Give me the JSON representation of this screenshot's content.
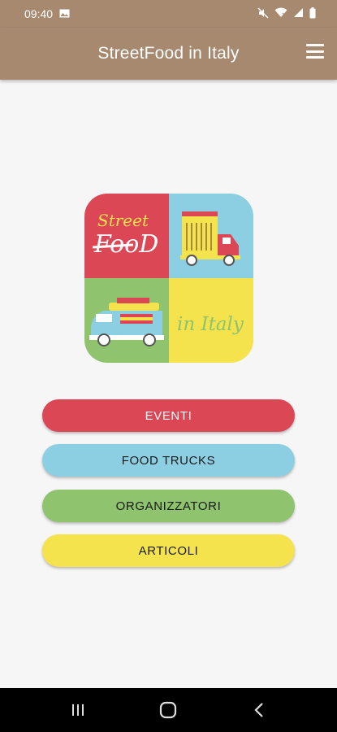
{
  "status_bar": {
    "time": "09:40",
    "icons": [
      "image-icon",
      "mute-icon",
      "wifi-icon",
      "signal-icon",
      "battery-icon"
    ]
  },
  "app_bar": {
    "title": "StreetFood in Italy",
    "menu_icon": "hamburger-menu-icon",
    "background_color": "#a6896f"
  },
  "logo": {
    "top_left_text_1": "Street",
    "top_left_text_2": "FooD",
    "bottom_right_text": "in Italy",
    "colors": {
      "red": "#dc4756",
      "blue": "#8dcfe2",
      "green": "#8fc36e",
      "yellow": "#f4e34d"
    }
  },
  "menu_buttons": [
    {
      "label": "EVENTI",
      "color": "#dc4756",
      "text_color": "#ffffff"
    },
    {
      "label": "FOOD TRUCKS",
      "color": "#8dcfe2",
      "text_color": "#1a1a1a"
    },
    {
      "label": "ORGANIZZATORI",
      "color": "#8fc36e",
      "text_color": "#1a1a1a"
    },
    {
      "label": "ARTICOLI",
      "color": "#f4e34d",
      "text_color": "#1a1a1a"
    }
  ],
  "nav_bar": {
    "icons": [
      "recent-apps-icon",
      "home-icon",
      "back-icon"
    ]
  }
}
